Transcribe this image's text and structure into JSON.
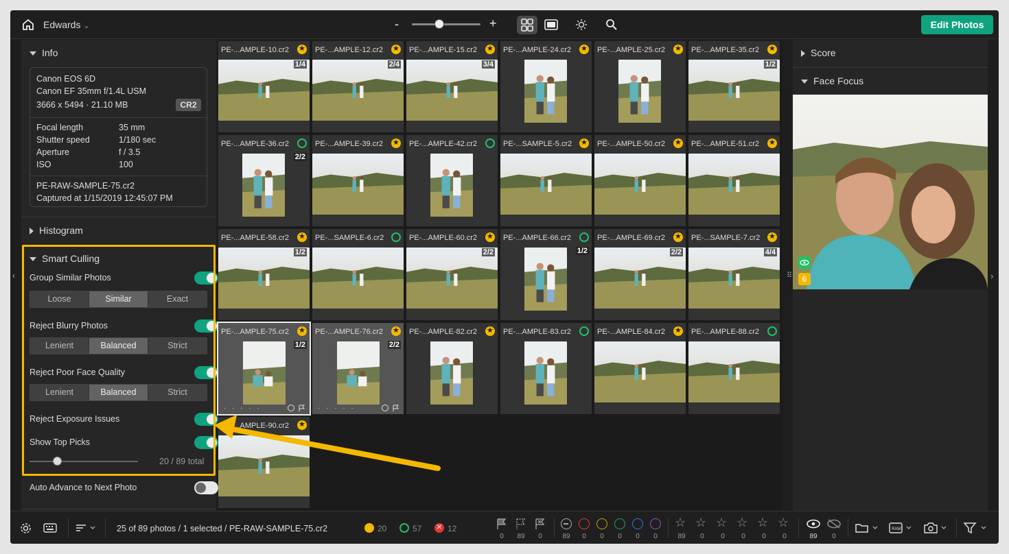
{
  "topbar": {
    "library": "Edwards",
    "zoom_minus": "-",
    "zoom_plus": "+",
    "edit_button": "Edit Photos"
  },
  "info": {
    "title": "Info",
    "camera": "Canon EOS 6D",
    "lens": "Canon EF 35mm f/1.4L USM",
    "dimensions": "3666 x 5494 · 21.10 MB",
    "format": "CR2",
    "rows": [
      {
        "label": "Focal length",
        "value": "35 mm"
      },
      {
        "label": "Shutter speed",
        "value": "1/180 sec"
      },
      {
        "label": "Aperture",
        "value": "f / 3.5"
      },
      {
        "label": "ISO",
        "value": "100"
      }
    ],
    "filename": "PE-RAW-SAMPLE-75.cr2",
    "captured": "Captured at 1/15/2019 12:45:07 PM"
  },
  "histogram": {
    "title": "Histogram"
  },
  "smart_culling": {
    "title": "Smart Culling",
    "group_similar": {
      "label": "Group Similar Photos",
      "options": [
        "Loose",
        "Similar",
        "Exact"
      ],
      "selected": 1
    },
    "reject_blurry": {
      "label": "Reject Blurry Photos",
      "options": [
        "Lenient",
        "Balanced",
        "Strict"
      ],
      "selected": 1
    },
    "reject_face": {
      "label": "Reject Poor Face Quality",
      "options": [
        "Lenient",
        "Balanced",
        "Strict"
      ],
      "selected": 1
    },
    "reject_exposure": {
      "label": "Reject Exposure Issues"
    },
    "top_picks": {
      "label": "Show Top Picks",
      "value": "20",
      "total": "/ 89 total"
    }
  },
  "auto_advance": {
    "label": "Auto Advance to Next Photo"
  },
  "photos": [
    {
      "name": "PE-...AMPLE-10.cr2",
      "badge": "star",
      "stack": "1/4"
    },
    {
      "name": "PE-...AMPLE-12.cr2",
      "badge": "star",
      "stack": "2/4"
    },
    {
      "name": "PE-...AMPLE-15.cr2",
      "badge": "star",
      "stack": "3/4"
    },
    {
      "name": "PE-...AMPLE-24.cr2",
      "badge": "star",
      "stack": ""
    },
    {
      "name": "PE-...AMPLE-25.cr2",
      "badge": "star",
      "stack": ""
    },
    {
      "name": "PE-...AMPLE-35.cr2",
      "badge": "star",
      "stack": "1/2"
    },
    {
      "name": "PE-...AMPLE-36.cr2",
      "badge": "green",
      "stack": "2/2"
    },
    {
      "name": "PE-...AMPLE-39.cr2",
      "badge": "star",
      "stack": ""
    },
    {
      "name": "PE-...AMPLE-42.cr2",
      "badge": "green",
      "stack": ""
    },
    {
      "name": "PE-...SAMPLE-5.cr2",
      "badge": "star",
      "stack": ""
    },
    {
      "name": "PE-...AMPLE-50.cr2",
      "badge": "star",
      "stack": ""
    },
    {
      "name": "PE-...AMPLE-51.cr2",
      "badge": "star",
      "stack": ""
    },
    {
      "name": "PE-...AMPLE-58.cr2",
      "badge": "star",
      "stack": "1/2"
    },
    {
      "name": "PE-...SAMPLE-6.cr2",
      "badge": "green",
      "stack": ""
    },
    {
      "name": "PE-...AMPLE-60.cr2",
      "badge": "star",
      "stack": "2/2"
    },
    {
      "name": "PE-...AMPLE-66.cr2",
      "badge": "green",
      "stack": "1/2"
    },
    {
      "name": "PE-...AMPLE-69.cr2",
      "badge": "star",
      "stack": "2/2"
    },
    {
      "name": "PE-...SAMPLE-7.cr2",
      "badge": "star",
      "stack": "4/4"
    },
    {
      "name": "PE-...AMPLE-75.cr2",
      "badge": "star",
      "stack": "1/2"
    },
    {
      "name": "PE-...AMPLE-76.cr2",
      "badge": "star",
      "stack": "2/2"
    },
    {
      "name": "PE-...AMPLE-82.cr2",
      "badge": "star",
      "stack": ""
    },
    {
      "name": "PE-...AMPLE-83.cr2",
      "badge": "green",
      "stack": ""
    },
    {
      "name": "PE-...AMPLE-84.cr2",
      "badge": "star",
      "stack": ""
    },
    {
      "name": "PE-...AMPLE-88.cr2",
      "badge": "green",
      "stack": ""
    },
    {
      "name": "PE-...AMPLE-90.cr2",
      "badge": "star",
      "stack": ""
    }
  ],
  "right": {
    "score": "Score",
    "face_focus": "Face Focus",
    "face_count": "6"
  },
  "status": {
    "summary": "25 of 89 photos / 1 selected / PE-RAW-SAMPLE-75.cr2",
    "stars": "20",
    "greens": "57",
    "rejects": "12",
    "flag_counts": [
      "0",
      "89",
      "0"
    ],
    "color_counts": [
      "89",
      "0",
      "0",
      "0",
      "0",
      "0"
    ],
    "star_counts": [
      "89",
      "0",
      "0",
      "0",
      "0",
      "0"
    ],
    "eye_counts": [
      "89",
      "0"
    ]
  },
  "colors": {
    "accent": "#10a37f",
    "star": "#f5b800",
    "pick": "#21c068",
    "reject": "#e53935"
  }
}
